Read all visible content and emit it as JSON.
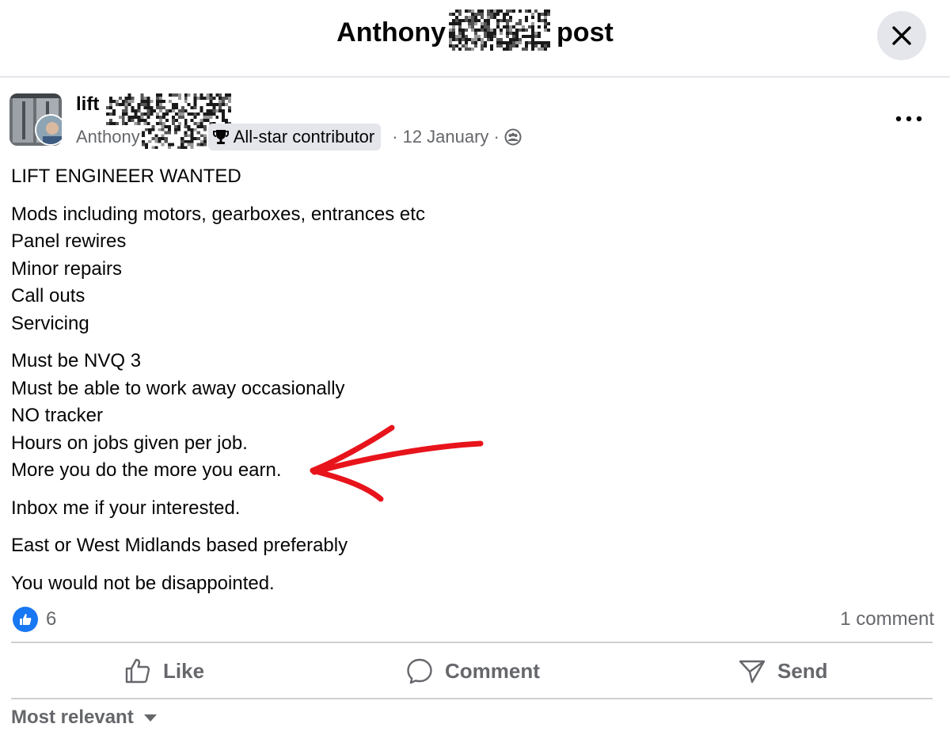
{
  "header": {
    "title_prefix": "Anthony",
    "title_suffix": "post",
    "close_icon": "close-icon"
  },
  "post": {
    "group_name": "lift",
    "author": "Anthony",
    "badge_label": "All-star contributor",
    "badge_icon": "trophy-icon",
    "date": "12 January",
    "privacy_icon": "group-icon",
    "body": {
      "heading": "LIFT ENGINEER WANTED",
      "duties": [
        "Mods including motors, gearboxes, entrances etc",
        "Panel rewires",
        "Minor repairs",
        "Call outs",
        "Servicing"
      ],
      "requirements": [
        "Must be NVQ 3",
        "Must be able to work away occasionally",
        "NO tracker",
        "Hours on jobs given per job.",
        "More you do the more you earn."
      ],
      "contact": "Inbox me if your interested.",
      "location": "East or West Midlands based preferably",
      "closing": "You would not be disappointed."
    },
    "reactions_count": "6",
    "comments_count": "1 comment"
  },
  "actions": {
    "like": "Like",
    "comment": "Comment",
    "send": "Send"
  },
  "comments": {
    "sort_label": "Most relevant"
  },
  "colors": {
    "accent": "#1877f2",
    "annotation": "#e8141b",
    "muted_text": "#65676b"
  }
}
